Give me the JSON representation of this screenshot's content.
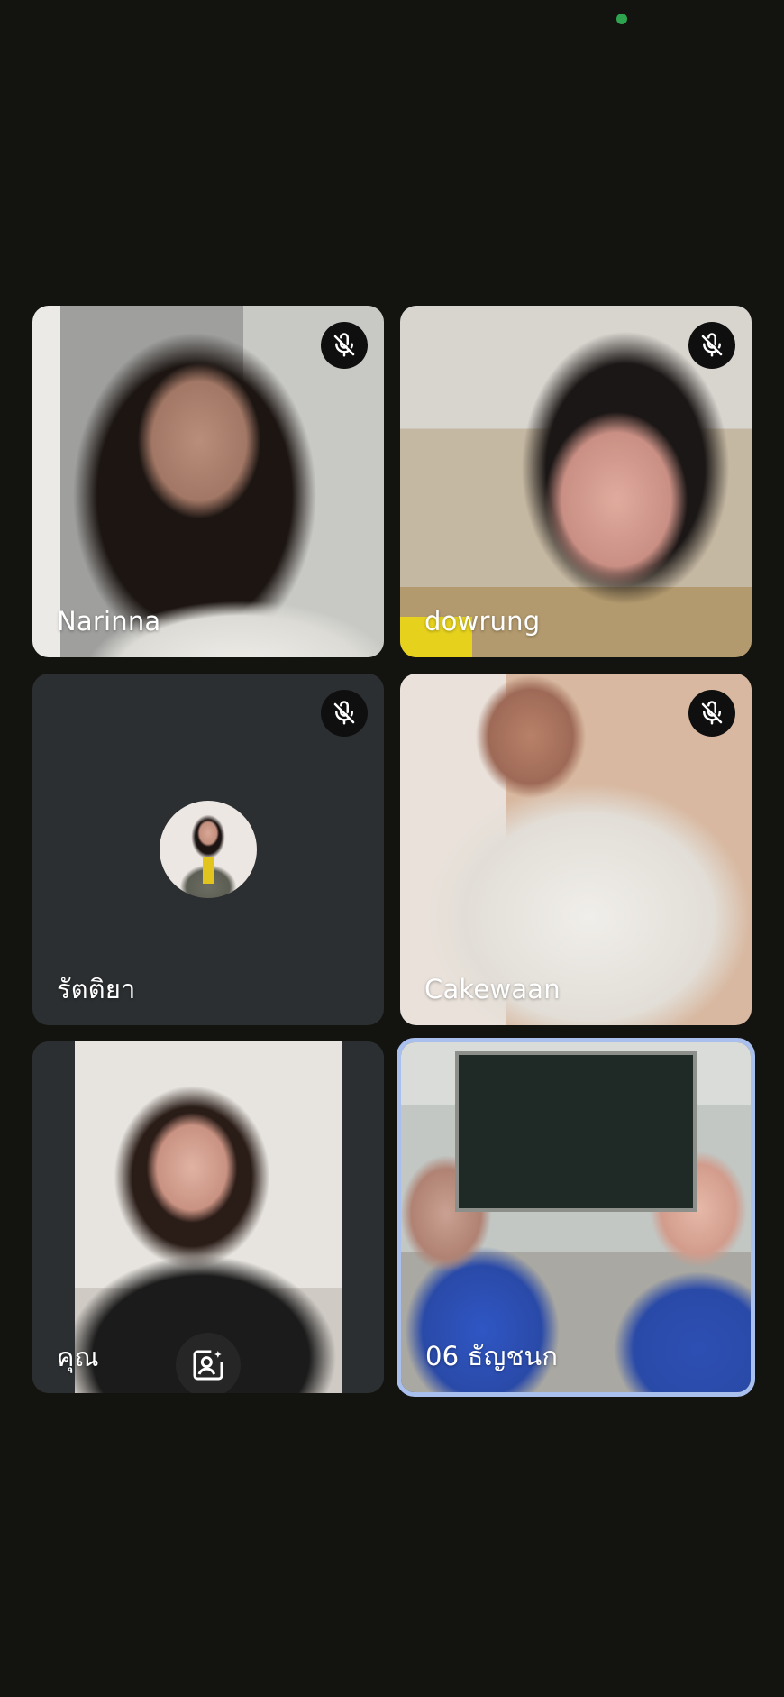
{
  "status": {
    "indicator_color": "#2ea44f"
  },
  "participants": [
    {
      "name": "Narinna",
      "muted": true,
      "mute_icon": "mic-off-icon"
    },
    {
      "name": "dowrung",
      "muted": true,
      "mute_icon": "mic-off-icon"
    },
    {
      "name": "รัตติยา",
      "muted": true,
      "mute_icon": "mic-off-icon",
      "video": "off",
      "avatar_icon": "avatar"
    },
    {
      "name": "Cakewaan",
      "muted": true,
      "mute_icon": "mic-off-icon"
    },
    {
      "name": "คุณ",
      "is_self": true,
      "effects_icon": "portrait-effects-icon"
    },
    {
      "name": "06 ธัญชนก",
      "active_speaker": true,
      "highlight_color": "#a9c0ef"
    }
  ]
}
